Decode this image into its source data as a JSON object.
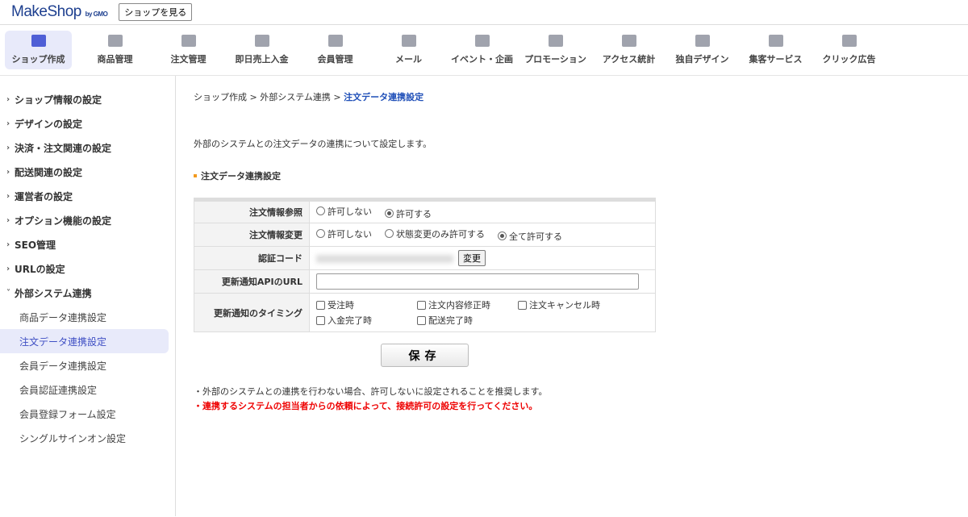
{
  "header": {
    "logo": "MakeShop",
    "logo_sub": "by GMO",
    "view_shop": "ショップを見る"
  },
  "nav": [
    {
      "label": "ショップ作成",
      "icon": "shop-icon"
    },
    {
      "label": "商品管理",
      "icon": "basket-icon"
    },
    {
      "label": "注文管理",
      "icon": "clipboard-icon"
    },
    {
      "label": "即日売上入金",
      "icon": "folder-icon"
    },
    {
      "label": "会員管理",
      "icon": "people-icon"
    },
    {
      "label": "メール",
      "icon": "mail-icon"
    },
    {
      "label": "イベント・企画",
      "icon": "gift-icon"
    },
    {
      "label": "プロモーション",
      "icon": "speaker-icon"
    },
    {
      "label": "アクセス統計",
      "icon": "trend-icon"
    },
    {
      "label": "独自デザイン",
      "icon": "palette-icon"
    },
    {
      "label": "集客サービス",
      "icon": "globe-icon"
    },
    {
      "label": "クリック広告",
      "icon": "mouse-icon"
    }
  ],
  "sidebar": {
    "items": [
      "ショップ情報の設定",
      "デザインの設定",
      "決済・注文関連の設定",
      "配送関連の設定",
      "運営者の設定",
      "オプション機能の設定",
      "SEO管理",
      "URLの設定",
      "外部システム連携"
    ],
    "sub": [
      "商品データ連携設定",
      "注文データ連携設定",
      "会員データ連携設定",
      "会員認証連携設定",
      "会員登録フォーム設定",
      "シングルサインオン設定"
    ]
  },
  "breadcrumb": [
    "ショップ作成",
    "外部システム連携",
    "注文データ連携設定"
  ],
  "description": "外部のシステムとの注文データの連携について設定します。",
  "section_title": "注文データ連携設定",
  "form": {
    "ref_label": "注文情報参照",
    "ref_opts": [
      "許可しない",
      "許可する"
    ],
    "chg_label": "注文情報変更",
    "chg_opts": [
      "許可しない",
      "状態変更のみ許可する",
      "全て許可する"
    ],
    "code_label": "認証コード",
    "code_btn": "変更",
    "url_label": "更新通知APIのURL",
    "url_value": "",
    "timing_label": "更新通知のタイミング",
    "timing_opts": [
      "受注時",
      "注文内容修正時",
      "注文キャンセル時",
      "入金完了時",
      "配送完了時"
    ]
  },
  "save": "保存",
  "note": "・外部のシステムとの連携を行わない場合、許可しないに設定されることを推奨します。",
  "warning": "・連携するシステムの担当者からの依頼によって、接続許可の設定を行ってください。"
}
